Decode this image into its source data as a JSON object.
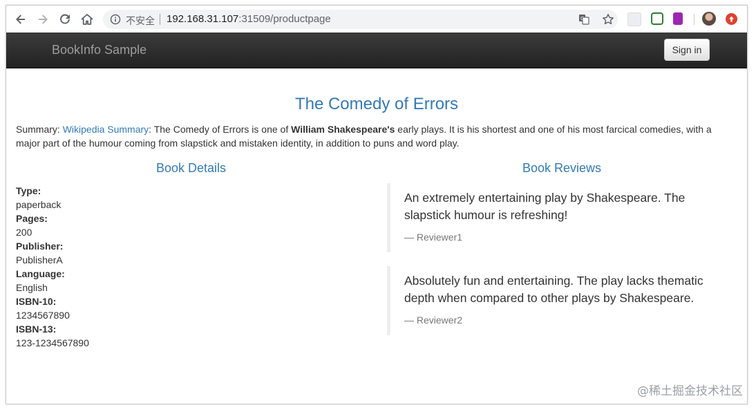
{
  "browser": {
    "security_label": "不安全",
    "url_host": "192.168.31.107",
    "url_rest": ":31509/productpage",
    "icons": [
      "back-icon",
      "forward-icon",
      "reload-icon",
      "home-icon",
      "info-icon",
      "translate-icon",
      "star-icon"
    ]
  },
  "navbar": {
    "brand": "BookInfo Sample",
    "sign_in_label": "Sign in"
  },
  "book": {
    "title": "The Comedy of Errors",
    "summary_prefix": "Summary: ",
    "summary_link": "Wikipedia Summary",
    "summary_text_1": ": The Comedy of Errors is one of ",
    "summary_bold": "William Shakespeare's",
    "summary_text_2": " early plays. It is his shortest and one of his most farcical comedies, with a major part of the humour coming from slapstick and mistaken identity, in addition to puns and word play."
  },
  "details": {
    "heading": "Book Details",
    "items": [
      {
        "label": "Type:",
        "value": "paperback"
      },
      {
        "label": "Pages:",
        "value": "200"
      },
      {
        "label": "Publisher:",
        "value": "PublisherA"
      },
      {
        "label": "Language:",
        "value": "English"
      },
      {
        "label": "ISBN-10:",
        "value": "1234567890"
      },
      {
        "label": "ISBN-13:",
        "value": "123-1234567890"
      }
    ]
  },
  "reviews": {
    "heading": "Book Reviews",
    "items": [
      {
        "text": "An extremely entertaining play by Shakespeare. The slapstick humour is refreshing!",
        "author": "— Reviewer1"
      },
      {
        "text": "Absolutely fun and entertaining. The play lacks thematic depth when compared to other plays by Shakespeare.",
        "author": "— Reviewer2"
      }
    ]
  },
  "watermark": "@稀土掘金技术社区"
}
